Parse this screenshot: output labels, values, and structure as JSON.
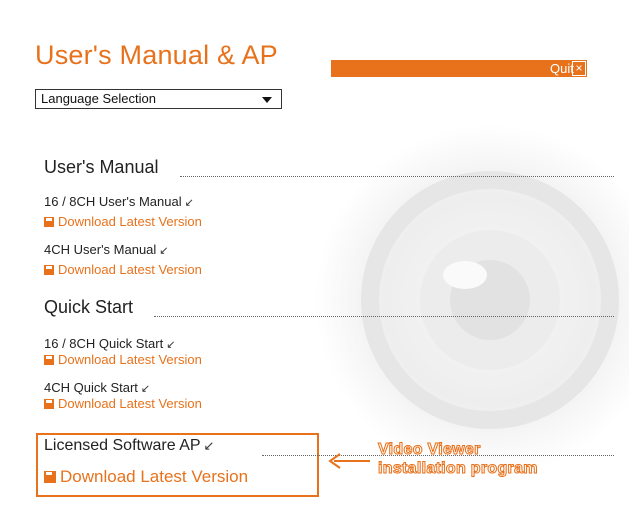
{
  "header": {
    "title": "User's Manual & AP",
    "quit_label": "Quit",
    "close_glyph": "×"
  },
  "language_select": {
    "selected": "Language Selection"
  },
  "sections": {
    "users_manual": {
      "heading": "User's Manual",
      "items": [
        {
          "label": "16 / 8CH User's Manual",
          "download": "Download Latest Version"
        },
        {
          "label": "4CH User's Manual",
          "download": "Download Latest Version"
        }
      ]
    },
    "quick_start": {
      "heading": "Quick Start",
      "items": [
        {
          "label": "16 / 8CH Quick Start",
          "download": "Download Latest Version"
        },
        {
          "label": "4CH Quick Start",
          "download": "Download Latest Version"
        }
      ]
    },
    "licensed_ap": {
      "heading": "Licensed Software AP",
      "download": "Download Latest Version"
    }
  },
  "callout": {
    "line1": "Video Viewer",
    "line2": "installation program"
  },
  "icons": {
    "arrow": "↙",
    "download": "floppy-disk-icon"
  },
  "colors": {
    "accent": "#e8721c",
    "text": "#222222"
  }
}
